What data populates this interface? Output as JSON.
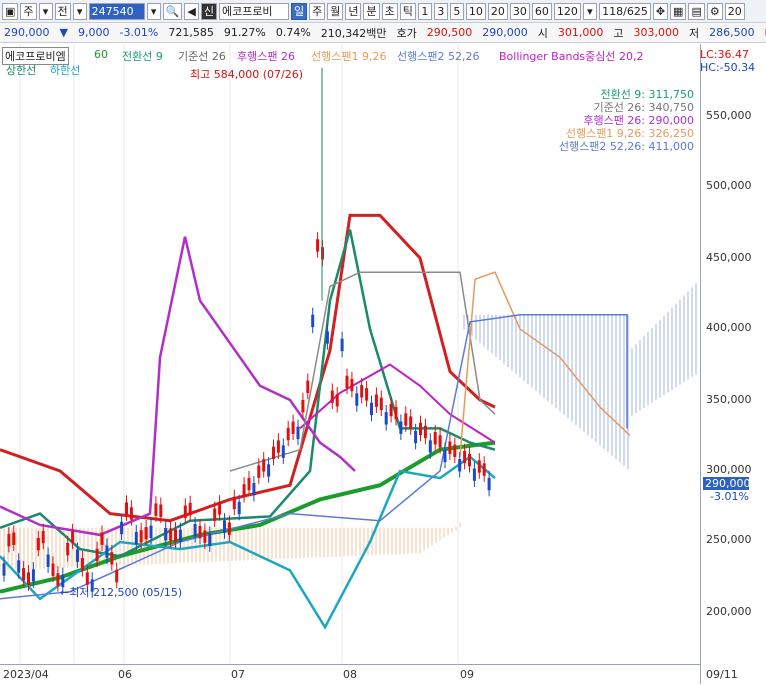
{
  "toolbar": {
    "mode": "주",
    "type": "전",
    "code": "247540",
    "badge": "신",
    "name": "에코프로비",
    "periods": [
      "일",
      "주",
      "월",
      "년",
      "분",
      "초",
      "틱"
    ],
    "selected_period": "일",
    "numbers": [
      "1",
      "3",
      "5",
      "10",
      "20",
      "30",
      "60",
      "120"
    ],
    "pager": "118/625",
    "right_count": "20"
  },
  "quote": {
    "price": "290,000",
    "change": "9,000",
    "change_pct": "-3.01%",
    "volume": "721,585",
    "ratio": "91.27%",
    "ratio2": "0.74%",
    "amount": "210,342백만",
    "bid_label": "호가",
    "bid": "290,500",
    "ask": "290,000",
    "open_label": "시",
    "open": "301,000",
    "high_label": "고",
    "high": "303,000",
    "low_label": "저",
    "low": "286,500",
    "trade_label": "매수"
  },
  "legend": {
    "main": "에코프로비엠",
    "ma": "60",
    "tenkan": "전환선 9",
    "kijun": "기준선 26",
    "chikou": "후행스팬 26",
    "senkou1": "선행스팬1 9,26",
    "senkou2": "선행스팬2 52,26",
    "boll": "Bollinger Bands중심선 20,2",
    "upper": "상한선",
    "lower": "하한선",
    "lc": "LC:36.47",
    "hc": "HC:-50.34"
  },
  "annotations": {
    "high": "최고 584,000 (07/26)",
    "low": "←최저 212,500 (05/15)"
  },
  "values": {
    "tenkan": "전환선 9: 311,750",
    "kijun": "기준선 26: 340,750",
    "chikou": "후행스팬 26: 290,000",
    "senkou1": "선행스팬1 9,26: 326,250",
    "senkou2": "선행스팬2 52,26: 411,000"
  },
  "y_axis": [
    "550,000",
    "500,000",
    "450,000",
    "400,000",
    "350,000",
    "300,000",
    "250,000",
    "200,000"
  ],
  "x_axis": [
    "2023/04",
    "06",
    "07",
    "08",
    "09",
    "09/11"
  ],
  "price_tag": {
    "value": "290,000",
    "pct": "-3.01%"
  },
  "colors": {
    "tenkan": "#1a9a7a",
    "kijun": "#8a8a8a",
    "chikou": "#b02fc8",
    "senkou1": "#e69a5a",
    "senkou2": "#5a7ad8",
    "boll": "#d22020",
    "upper": "#1a8a6a",
    "lower": "#1aa8c0",
    "ma60": "#1c9c2c",
    "up": "#e01010",
    "down": "#1a4ac8"
  },
  "chart_data": {
    "type": "line",
    "ylim": [
      180000,
      590000
    ],
    "x": [
      "2023/04",
      "06",
      "07",
      "08",
      "09",
      "09/11"
    ],
    "series": [
      {
        "name": "60",
        "values": [
          210000,
          228000,
          255000,
          290000,
          318000
        ]
      },
      {
        "name": "전환선 9",
        "values": [
          265000,
          262000,
          270000,
          475000,
          311750
        ]
      },
      {
        "name": "기준선 26",
        "values": [
          250000,
          255000,
          262000,
          395000,
          340750
        ]
      },
      {
        "name": "후행스팬 26",
        "values": [
          275000,
          262000,
          460000,
          360000,
          290000
        ]
      },
      {
        "name": "선행스팬1 9,26",
        "values": [
          258000,
          260000,
          268000,
          440000,
          326250
        ]
      },
      {
        "name": "선행스팬2 52,26",
        "values": [
          210000,
          255000,
          268000,
          405000,
          411000
        ]
      }
    ]
  }
}
